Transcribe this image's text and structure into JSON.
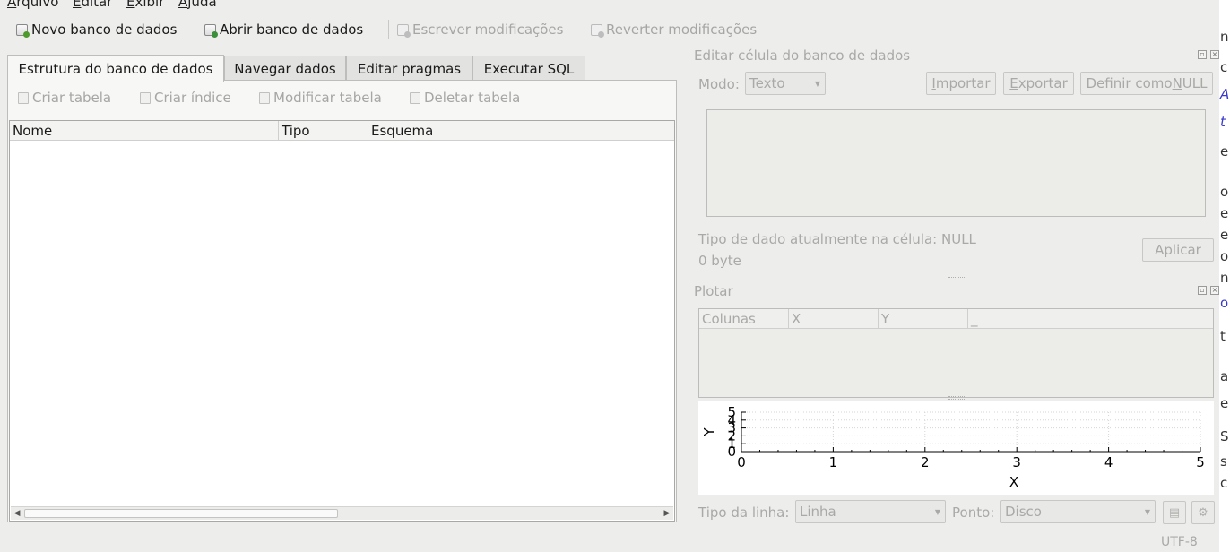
{
  "menu": {
    "items": [
      "Arquivo",
      "Editar",
      "Exibir",
      "Ajuda"
    ],
    "mnemonic": [
      "A",
      "E",
      "E",
      "A"
    ],
    "rest": [
      "rquivo",
      "ditar",
      "xibir",
      "juda"
    ]
  },
  "toolbar": {
    "new_db": "Novo banco de dados",
    "open_db": "Abrir banco de dados",
    "write_changes": "Escrever modificações",
    "revert_changes": "Reverter modificações"
  },
  "tabs": [
    "Estrutura do banco de dados",
    "Navegar dados",
    "Editar pragmas",
    "Executar SQL"
  ],
  "structure": {
    "create_table": "Criar tabela",
    "create_index": "Criar índice",
    "modify_table": "Modificar tabela",
    "delete_table": "Deletar tabela",
    "columns": [
      "Nome",
      "Tipo",
      "Esquema"
    ]
  },
  "edit_cell": {
    "title": "Editar célula do banco de dados",
    "mode_label": "Modo:",
    "mode_value": "Texto",
    "import_m": "I",
    "import_rest": "mportar",
    "export_m": "E",
    "export_rest": "xportar",
    "set_null_pre": "Definir como ",
    "set_null_m": "N",
    "set_null_rest": "ULL",
    "type_info": "Tipo de dado atualmente na célula: NULL",
    "size_info": "0 byte",
    "apply": "Aplicar"
  },
  "plot": {
    "title": "Plotar",
    "columns": [
      "Colunas",
      "X",
      "Y",
      "_"
    ],
    "line_type_label": "Tipo da linha:",
    "line_type_value": "Linha",
    "point_label": "Ponto:",
    "point_value": "Disco"
  },
  "chart_data": {
    "type": "scatter",
    "series": [],
    "xlabel": "X",
    "ylabel": "Y",
    "xlim": [
      0,
      5
    ],
    "ylim": [
      0,
      5
    ],
    "xticks": [
      "0",
      "1",
      "2",
      "3",
      "4",
      "5"
    ],
    "yticks": [
      "0",
      "1",
      "2",
      "3",
      "4",
      "5"
    ],
    "grid": true
  },
  "status": {
    "encoding": "UTF-8"
  },
  "edge_text": [
    "n",
    "c",
    "A",
    "t",
    "e",
    "o",
    "e",
    "e",
    "o",
    "n",
    "o",
    "t",
    "a",
    "e",
    "S",
    "s",
    "c"
  ]
}
